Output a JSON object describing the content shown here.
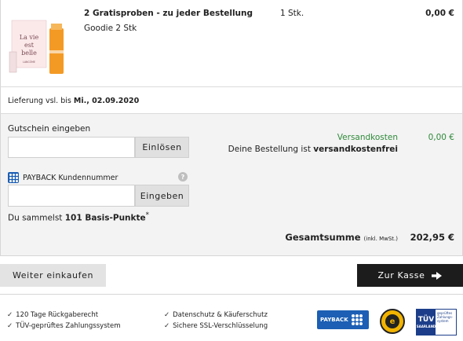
{
  "product": {
    "title": "2 Gratisproben - zu jeder Bestellung",
    "subtitle": "Goodie 2 Stk",
    "quantity": "1 Stk.",
    "price": "0,00 €",
    "image_text": "La vie est belle",
    "image_brand": "LANCÔME"
  },
  "delivery": {
    "prefix": "Lieferung vsl. bis",
    "date": "Mi., 02.09.2020"
  },
  "coupon": {
    "label": "Gutschein eingeben",
    "value": "",
    "button": "Einlösen"
  },
  "payback": {
    "label": "PAYBACK Kundennummer",
    "value": "",
    "button": "Eingeben",
    "help": "?",
    "points_prefix": "Du sammelst",
    "points_value": "101 Basis-Punkte",
    "points_suffix": "*"
  },
  "shipping": {
    "label": "Versandkosten",
    "value": "0,00 €",
    "free_prefix": "Deine Bestellung ist",
    "free_bold": "versandkostenfrei",
    "color": "#2f8a3a"
  },
  "total": {
    "label": "Gesamtsumme",
    "note": "(inkl. MwSt.)",
    "value": "202,95 €"
  },
  "actions": {
    "continue": "Weiter einkaufen",
    "checkout": "Zur Kasse"
  },
  "features": [
    "120 Tage Rückgaberecht",
    "TÜV-geprüftes Zahlungssystem",
    "Datenschutz & Käuferschutz",
    "Sichere SSL-Verschlüsselung"
  ],
  "badges": {
    "payback": "PAYBACK",
    "trusted_shops": "e",
    "tuv_main": "TÜV",
    "tuv_region": "SAARLAND",
    "tuv_caption": "geprüftes Zahlungs-system"
  }
}
